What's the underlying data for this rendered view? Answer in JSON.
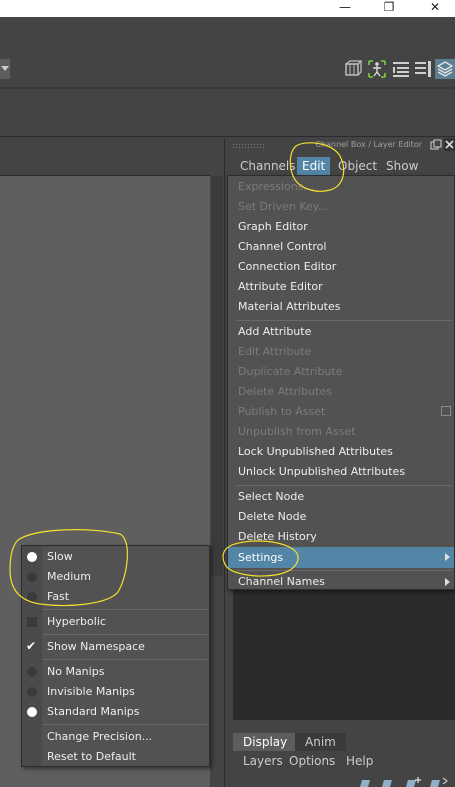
{
  "window": {
    "minimize": "—",
    "restore": "❐",
    "close": "✕"
  },
  "channel_box": {
    "title": "Channel Box / Layer Editor",
    "menus": [
      "Channels",
      "Edit",
      "Object",
      "Show"
    ],
    "active_menu": "Edit"
  },
  "edit_menu": {
    "items": [
      {
        "label": "Expressions...",
        "enabled": false
      },
      {
        "label": "Set Driven Key...",
        "enabled": false
      },
      {
        "label": "Graph Editor",
        "enabled": true
      },
      {
        "label": "Channel Control",
        "enabled": true
      },
      {
        "label": "Connection Editor",
        "enabled": true
      },
      {
        "label": "Attribute Editor",
        "enabled": true
      },
      {
        "label": "Material Attributes",
        "enabled": true
      },
      {
        "label": "Add Attribute",
        "enabled": true
      },
      {
        "label": "Edit Attribute",
        "enabled": false
      },
      {
        "label": "Duplicate Attribute",
        "enabled": false
      },
      {
        "label": "Delete Attributes",
        "enabled": false
      },
      {
        "label": "Publish to Asset",
        "enabled": false
      },
      {
        "label": "Unpublish from Asset",
        "enabled": false
      },
      {
        "label": "Lock Unpublished Attributes",
        "enabled": true
      },
      {
        "label": "Unlock Unpublished Attributes",
        "enabled": true
      },
      {
        "label": "Select Node",
        "enabled": true
      },
      {
        "label": "Delete Node",
        "enabled": true
      },
      {
        "label": "Delete History",
        "enabled": true
      },
      {
        "label": "Settings",
        "enabled": true
      },
      {
        "label": "Channel Names",
        "enabled": true
      }
    ],
    "highlighted": "Settings"
  },
  "settings_submenu": {
    "speed": [
      {
        "label": "Slow",
        "selected": true
      },
      {
        "label": "Medium",
        "selected": false
      },
      {
        "label": "Fast",
        "selected": false
      }
    ],
    "hyperbolic": {
      "label": "Hyperbolic",
      "checked": false
    },
    "show_namespace": {
      "label": "Show Namespace",
      "checked": true
    },
    "manips": [
      {
        "label": "No Manips",
        "selected": false
      },
      {
        "label": "Invisible Manips",
        "selected": false
      },
      {
        "label": "Standard Manips",
        "selected": true
      }
    ],
    "actions": [
      "Change Precision...",
      "Reset to Default"
    ]
  },
  "layer_editor": {
    "tabs": [
      "Display",
      "Anim"
    ],
    "active_tab": "Display",
    "menus": [
      "Layers",
      "Options",
      "Help"
    ]
  },
  "colors": {
    "highlight": "#5285a6",
    "annotation": "#f2e12c",
    "panel_bg": "#444444",
    "menu_bg": "#525252"
  }
}
